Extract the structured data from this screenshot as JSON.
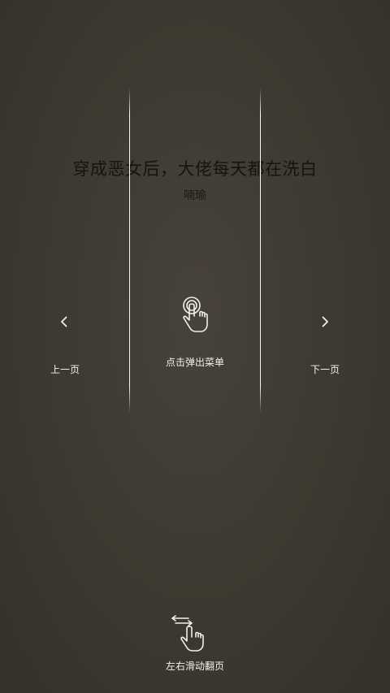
{
  "book": {
    "title": "穿成恶女后，大佬每天都在洗白",
    "author": "喃瑜"
  },
  "guide": {
    "prev_label": "上一页",
    "menu_label": "点击弹出菜单",
    "next_label": "下一页",
    "swipe_label": "左右滑动翻页"
  },
  "icons": {
    "prev": "chevron-left-icon",
    "next": "chevron-right-icon",
    "tap": "tap-hand-icon",
    "swipe": "swipe-hand-icon"
  },
  "colors": {
    "background": "#3d3930",
    "guide_text": "#f2f0ea",
    "title_text": "#151411"
  }
}
